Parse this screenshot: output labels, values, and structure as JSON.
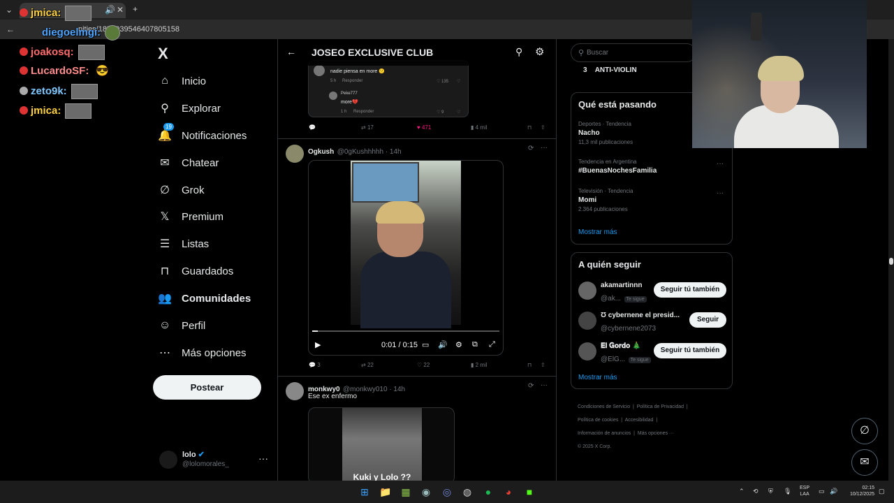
{
  "browser": {
    "tab_label": "jmica:",
    "url": "nities/1851039546407805158"
  },
  "chat": [
    {
      "name": "diegoelmgi:",
      "color": "#4da3ff"
    },
    {
      "name": "joakosq:",
      "color": "#ff6b6b"
    },
    {
      "name": "LucardoSF:",
      "color": "#ff8c8c"
    },
    {
      "name": "zeto9k:",
      "color": "#7ec8ff"
    },
    {
      "name": "jmica:",
      "color": "#ffd23f"
    }
  ],
  "nav": {
    "logo": "X",
    "items": [
      {
        "label": "Inicio",
        "icon": "⌂"
      },
      {
        "label": "Explorar",
        "icon": "⚲"
      },
      {
        "label": "Notificaciones",
        "icon": "🔔",
        "badge": "19"
      },
      {
        "label": "Chatear",
        "icon": "✉"
      },
      {
        "label": "Grok",
        "icon": "∅"
      },
      {
        "label": "Premium",
        "icon": "𝕏"
      },
      {
        "label": "Listas",
        "icon": "☰"
      },
      {
        "label": "Guardados",
        "icon": "⊓"
      },
      {
        "label": "Comunidades",
        "icon": "👥"
      },
      {
        "label": "Perfil",
        "icon": "☺"
      },
      {
        "label": "Más opciones",
        "icon": "⋯"
      }
    ],
    "post_button": "Postear",
    "account": {
      "name": "lolo",
      "handle": "@lolomorales_"
    }
  },
  "main": {
    "title": "JOSEO EXCLUSIVE CLUB",
    "quote": {
      "reply1": {
        "text": "nadie piensa en more 🙁",
        "time": "5 h",
        "reply": "Responder",
        "likes": "135"
      },
      "reply2": {
        "user": "Peke777",
        "text": "more💔",
        "time": "1 h",
        "reply": "Responder",
        "likes": "9"
      }
    },
    "post1_stats": {
      "replies": "",
      "reposts": "17",
      "likes": "471",
      "views": "4 mil"
    },
    "post2": {
      "name": "Ogkush",
      "handle": "@0gKushhhhh · 14h",
      "video_time": "0:01 / 0:15",
      "stats": {
        "replies": "3",
        "reposts": "22",
        "likes": "22",
        "views": "2 mil"
      }
    },
    "post3": {
      "name": "monkwy0",
      "handle": "@monkwy010 · 14h",
      "text": "Ese ex enfermo",
      "caption": "Kuki y Lolo ??"
    }
  },
  "right": {
    "search_placeholder": "Buscar",
    "top_item": {
      "rank": "3",
      "label": "ANTI-VIOLIN"
    },
    "trends_title": "Qué está pasando",
    "trends": [
      {
        "meta": "Deportes · Tendencia",
        "name": "Nacho",
        "count": "11,3 mil publicaciones"
      },
      {
        "meta": "Tendencia en Argentina",
        "name": "#BuenasNochesFamilia",
        "count": ""
      },
      {
        "meta": "Televisión · Tendencia",
        "name": "Momi",
        "count": "2.364 publicaciones"
      }
    ],
    "show_more": "Mostrar más",
    "follow_title": "A quién seguir",
    "follow": [
      {
        "name": "akamartinnn",
        "handle": "@ak...",
        "tag": "Te sigue",
        "button": "Seguir tú también"
      },
      {
        "name": "Ʊ cybernene el presid...",
        "handle": "@cybernene2073",
        "tag": "",
        "button": "Seguir"
      },
      {
        "name": "𝐄𝐥 𝐆𝐨𝐫𝐝𝐨 🎄",
        "handle": "@ElG...",
        "tag": "Te sigue",
        "button": "Seguir tú también"
      }
    ],
    "follow_more": "Mostrar más",
    "footer": [
      "Condiciones de Servicio",
      "Política de Privacidad",
      "Política de cookies",
      "Accesibilidad",
      "Información de anuncios",
      "Más opciones ···",
      "© 2025 X Corp."
    ]
  },
  "taskbar": {
    "lang": "ESP",
    "lang2": "LAA",
    "time": "02:15",
    "date": "10/12/2025"
  }
}
